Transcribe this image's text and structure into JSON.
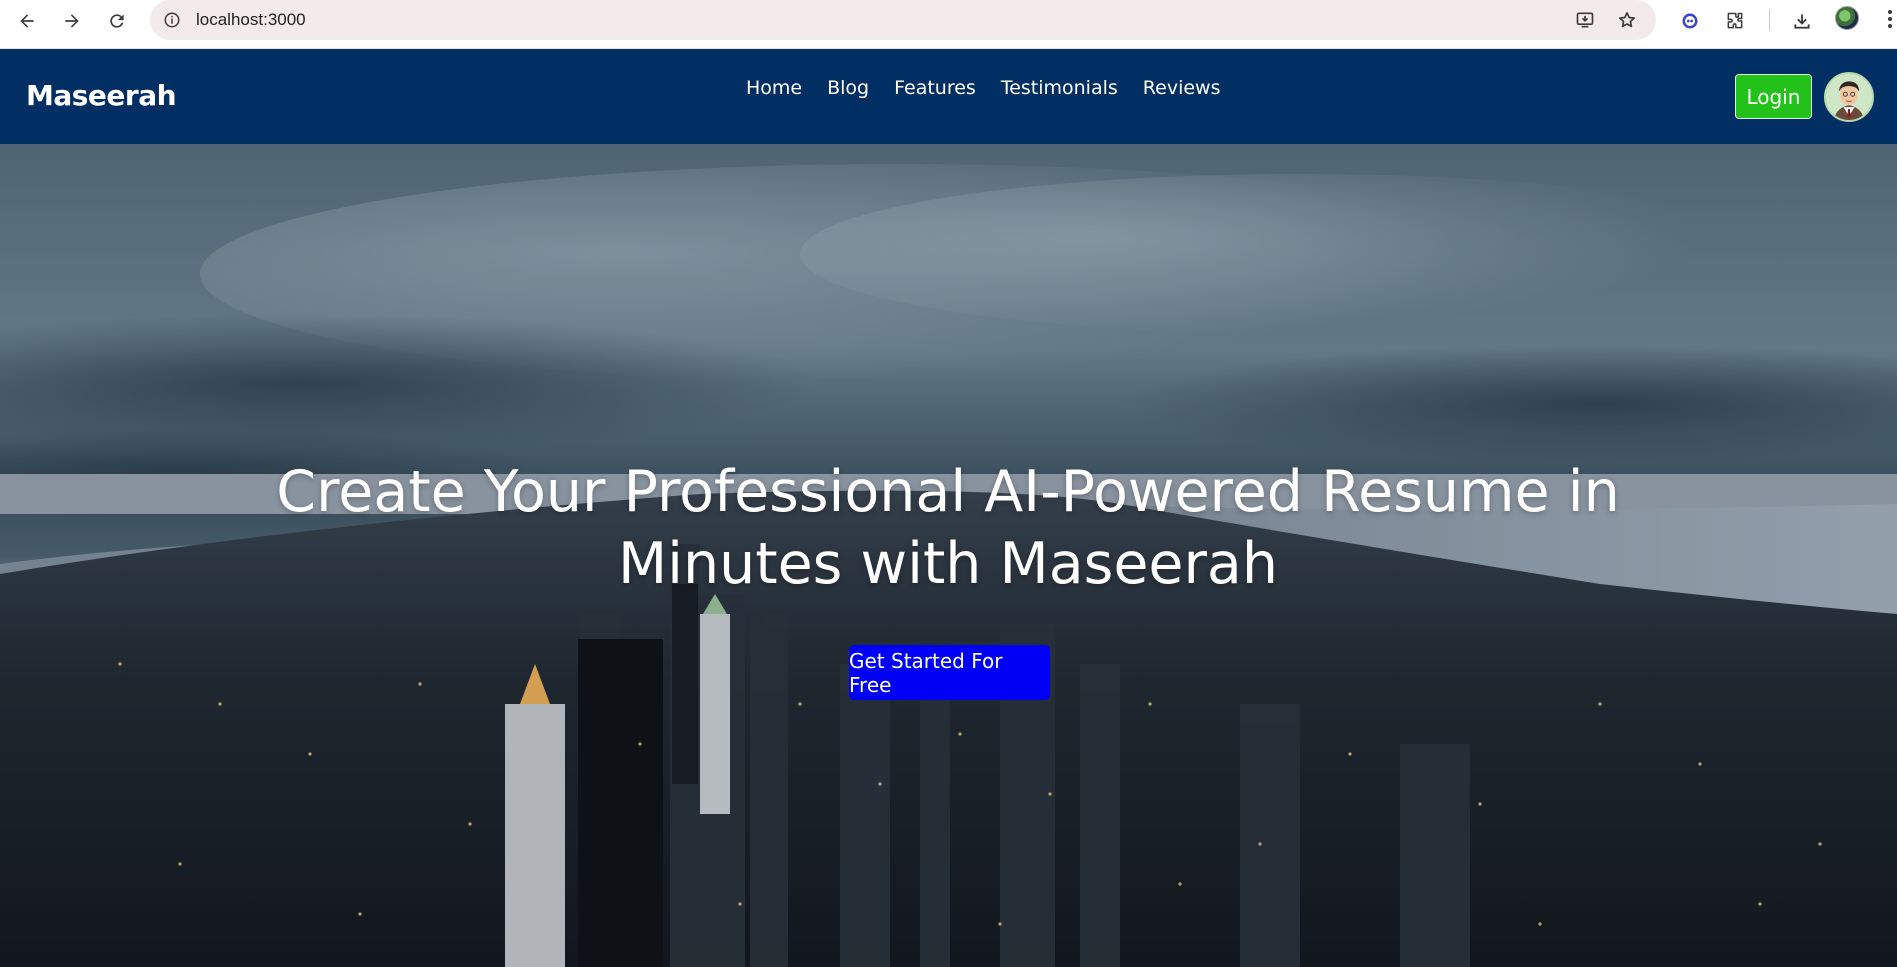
{
  "browser": {
    "url": "localhost:3000",
    "icons": {
      "back": "back-arrow-icon",
      "forward": "forward-arrow-icon",
      "reload": "reload-icon",
      "site_info": "site-info-icon",
      "install": "install-app-icon",
      "bookmark": "bookmark-star-icon",
      "extension_a": "extension-icon",
      "extensions": "puzzle-icon",
      "downloads": "download-icon",
      "profile": "profile-avatar",
      "menu": "more-menu-icon"
    }
  },
  "navbar": {
    "brand": "Maseerah",
    "links": [
      {
        "label": "Home"
      },
      {
        "label": "Blog"
      },
      {
        "label": "Features"
      },
      {
        "label": "Testimonials"
      },
      {
        "label": "Reviews"
      }
    ],
    "login_label": "Login",
    "colors": {
      "background": "#022f63",
      "login": "#23c21b"
    }
  },
  "hero": {
    "title_line1": "Create Your Professional AI-Powered Resume in",
    "title_line2": "Minutes with Maseerah",
    "cta_label": "Get Started For Free",
    "cta_color": "#0000f5",
    "background_image": "city-skyline-dusk-photo"
  }
}
